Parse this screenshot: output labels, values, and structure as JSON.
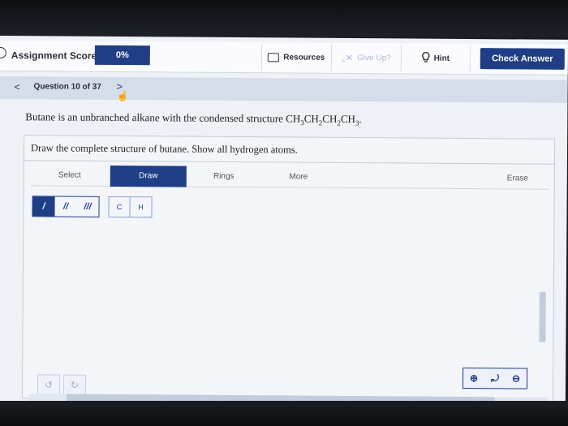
{
  "topbar": {
    "score_label": "Assignment Score:",
    "score_value": "0%",
    "resources_label": "Resources",
    "giveup_label": "Give Up?",
    "hint_label": "Hint",
    "check_label": "Check Answer"
  },
  "nav": {
    "prev_glyph": "<",
    "question_label": "Question 10 of 37",
    "next_glyph": ">"
  },
  "question": {
    "text_prefix": "Butane is an unbranched alkane with the condensed structure CH",
    "formula_parts": [
      "3",
      "CH",
      "2",
      "CH",
      "2",
      "CH",
      "3"
    ],
    "text_suffix": "."
  },
  "panel": {
    "instruction": "Draw the complete structure of butane. Show all hydrogen atoms.",
    "tabs": [
      "Select",
      "Draw",
      "Rings",
      "More",
      "Erase"
    ],
    "active_tab": "Draw",
    "bonds": [
      "/",
      "//",
      "///"
    ],
    "atoms": [
      "C",
      "H"
    ]
  },
  "icons": {
    "circle": "circle-icon",
    "resources": "document-icon",
    "giveup": "give-up-icon",
    "hint": "lightbulb-icon",
    "undo": "undo-icon",
    "redo": "redo-icon",
    "zoom_in": "zoom-in-icon",
    "zoom_reset": "zoom-reset-icon",
    "zoom_out": "zoom-out-icon"
  },
  "colors": {
    "accent": "#1f3e86",
    "nav_bar": "#d5dcea",
    "page_bg": "#eef1f6"
  }
}
